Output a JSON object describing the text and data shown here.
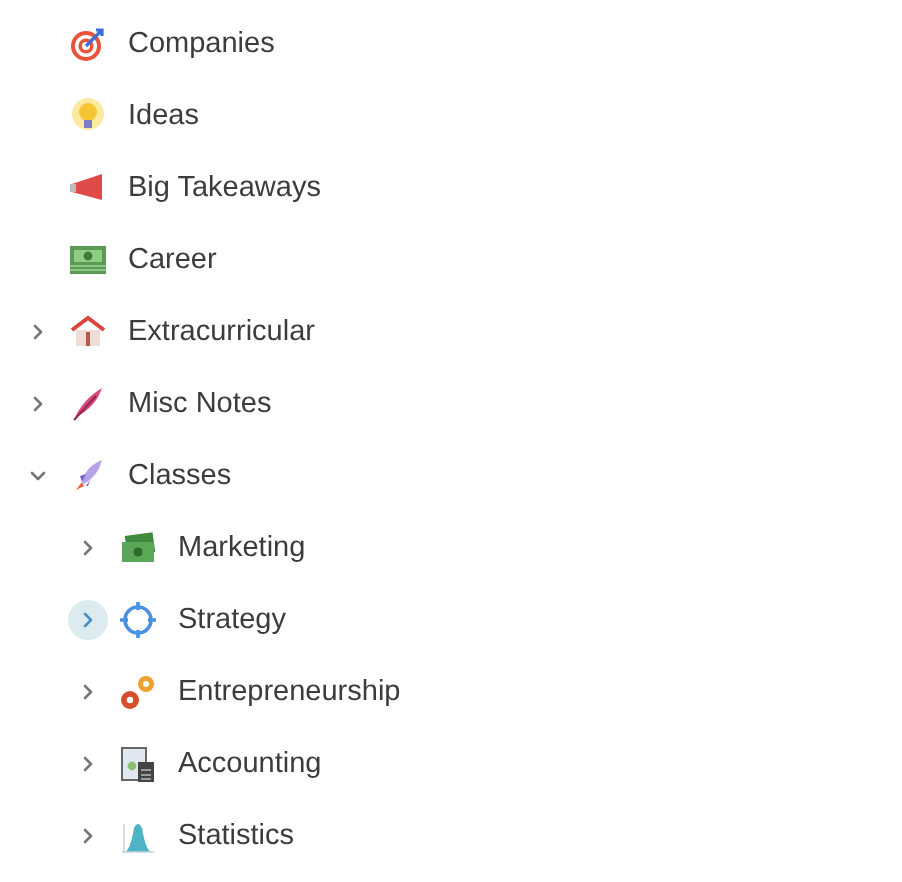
{
  "tree": [
    {
      "label": "Companies"
    },
    {
      "label": "Ideas"
    },
    {
      "label": "Big Takeaways"
    },
    {
      "label": "Career"
    },
    {
      "label": "Extracurricular",
      "expanded": false
    },
    {
      "label": "Misc Notes",
      "expanded": false
    },
    {
      "label": "Classes",
      "expanded": true,
      "children": [
        {
          "label": "Marketing",
          "expanded": false,
          "highlighted": false
        },
        {
          "label": "Strategy",
          "expanded": false,
          "highlighted": true
        },
        {
          "label": "Entrepreneurship",
          "expanded": false,
          "highlighted": false
        },
        {
          "label": "Accounting",
          "expanded": false,
          "highlighted": false
        },
        {
          "label": "Statistics",
          "expanded": false,
          "highlighted": false
        }
      ]
    }
  ]
}
